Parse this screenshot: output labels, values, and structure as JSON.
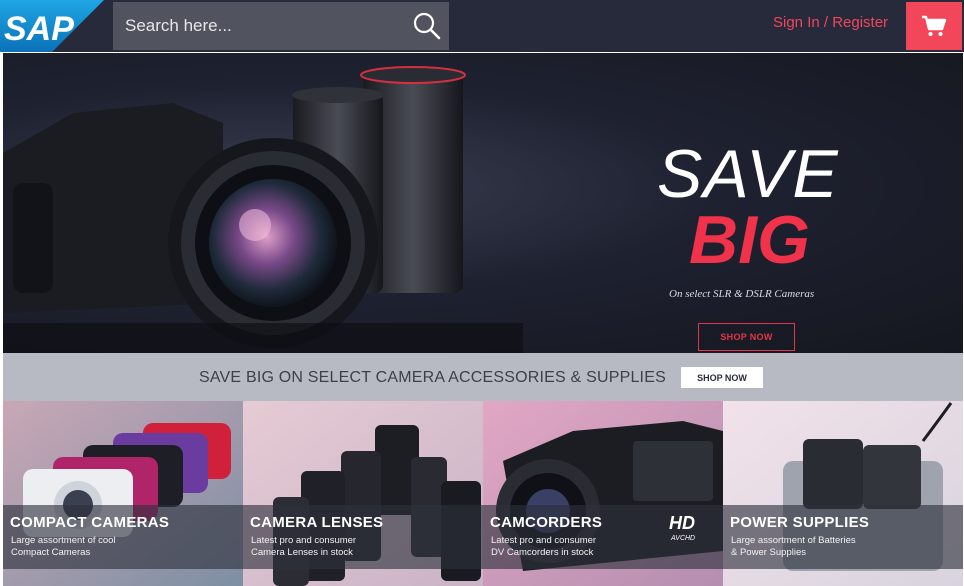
{
  "header": {
    "logo_text": "SAP",
    "search_placeholder": "Search here...",
    "signin_label": "Sign In / Register",
    "icons": {
      "search": "search-icon",
      "cart": "cart-icon"
    },
    "colors": {
      "bar": "#272a3b",
      "accent": "#f2475b"
    }
  },
  "hero": {
    "headline_line1": "SAVE",
    "headline_line2": "BIG",
    "subtitle": "On select SLR & DSLR Cameras",
    "button_label": "SHOP NOW"
  },
  "promo": {
    "text": "SAVE BIG ON SELECT CAMERA ACCESSORIES & SUPPLIES",
    "button_label": "SHOP NOW"
  },
  "categories": [
    {
      "title": "COMPACT CAMERAS",
      "desc_line1": "Large assortment of cool",
      "desc_line2": "Compact Cameras"
    },
    {
      "title": "CAMERA LENSES",
      "desc_line1": "Latest pro and consumer",
      "desc_line2": "Camera Lenses in stock"
    },
    {
      "title": "CAMCORDERS",
      "desc_line1": "Latest pro and consumer",
      "desc_line2": "DV Camcorders in stock",
      "badge": "HD",
      "badge_sub": "AVCHD"
    },
    {
      "title": "POWER SUPPLIES",
      "desc_line1": "Large assortment of Batteries",
      "desc_line2": "& Power Supplies"
    }
  ]
}
